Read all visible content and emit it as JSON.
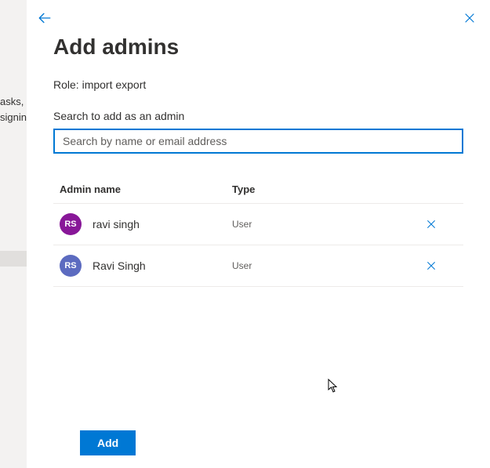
{
  "backdrop": {
    "line1": "asks, a",
    "line2": "signin"
  },
  "header": {
    "title": "Add admins",
    "role_prefix": "Role: ",
    "role_name": "import export"
  },
  "search": {
    "label": "Search to add as an admin",
    "placeholder": "Search by name or email address",
    "value": ""
  },
  "table": {
    "col_name": "Admin name",
    "col_type": "Type"
  },
  "rows": [
    {
      "initials": "RS",
      "name": "ravi singh",
      "type": "User",
      "avatar_color": "#881798"
    },
    {
      "initials": "RS",
      "name": "Ravi Singh",
      "type": "User",
      "avatar_color": "#5c6bc0"
    }
  ],
  "buttons": {
    "add": "Add"
  }
}
